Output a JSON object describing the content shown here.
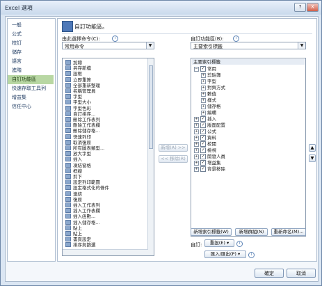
{
  "window": {
    "title": "Excel 選項",
    "help": "?",
    "close": "X"
  },
  "nav": {
    "items": [
      "一般",
      "公式",
      "校訂",
      "儲存",
      "語言",
      "進階",
      "自訂功能區",
      "快速存取工具列",
      "增益集",
      "信任中心"
    ],
    "selected_index": 6
  },
  "header": {
    "title": "自訂功能區。"
  },
  "left": {
    "label": "由此選擇命令(C):",
    "combo_value": "常用命令",
    "commands": [
      "加總",
      "另存新檔",
      "設框",
      "立即重算",
      "全部重新整理",
      "名稱管理員",
      "字型",
      "字型大小",
      "字型色彩",
      "自訂排序...",
      "刪除工作表列",
      "刪除工作表欄",
      "刪除儲存格...",
      "快速列印",
      "取消復原",
      "所有圖表類型...",
      "放大字型",
      "插入",
      "凍結窗格",
      "框線",
      "剪下",
      "設定列印範圍",
      "設定格式化的條件",
      "連結",
      "復原",
      "插入工作表列",
      "插入工作表欄",
      "插入函數...",
      "插入儲存格...",
      "貼上",
      "貼上",
      "書頁設定",
      "排序與篩選"
    ]
  },
  "middle": {
    "add": "新增(A) >>",
    "remove": "<< 移除(R)"
  },
  "right": {
    "label": "自訂功能區(B):",
    "combo_value": "主要索引標籤",
    "tree_header": "主要索引標籤",
    "tree": [
      {
        "text": "常用",
        "level": 0,
        "toggle": "⊟",
        "checked": true
      },
      {
        "text": "剪貼簿",
        "level": 1,
        "toggle": "⊞"
      },
      {
        "text": "字型",
        "level": 1,
        "toggle": "⊞"
      },
      {
        "text": "對齊方式",
        "level": 1,
        "toggle": "⊞"
      },
      {
        "text": "數值",
        "level": 1,
        "toggle": "⊞"
      },
      {
        "text": "樣式",
        "level": 1,
        "toggle": "⊞"
      },
      {
        "text": "儲存格",
        "level": 1,
        "toggle": "⊞"
      },
      {
        "text": "編輯",
        "level": 1,
        "toggle": "⊞"
      },
      {
        "text": "插入",
        "level": 0,
        "toggle": "⊞",
        "checked": true
      },
      {
        "text": "版面配置",
        "level": 0,
        "toggle": "⊞",
        "checked": true
      },
      {
        "text": "公式",
        "level": 0,
        "toggle": "⊞",
        "checked": true
      },
      {
        "text": "資料",
        "level": 0,
        "toggle": "⊞",
        "checked": true
      },
      {
        "text": "校閱",
        "level": 0,
        "toggle": "⊞",
        "checked": true
      },
      {
        "text": "檢視",
        "level": 0,
        "toggle": "⊞",
        "checked": true
      },
      {
        "text": "開發人員",
        "level": 0,
        "toggle": "⊞",
        "checked": true
      },
      {
        "text": "增益集",
        "level": 0,
        "toggle": "⊞",
        "checked": true
      },
      {
        "text": "背景移除",
        "level": 0,
        "toggle": "⊞",
        "checked": true
      }
    ],
    "new_tab": "新增索引標籤(W)",
    "new_group": "新增群組(N)",
    "rename": "重新命名(M)...",
    "customize_label": "自訂:",
    "reset": "重設(E) ▾",
    "import_export": "匯入/匯出(P) ▾",
    "move_up": "▲",
    "move_down": "▼"
  },
  "footer": {
    "ok": "確定",
    "cancel": "取消"
  }
}
